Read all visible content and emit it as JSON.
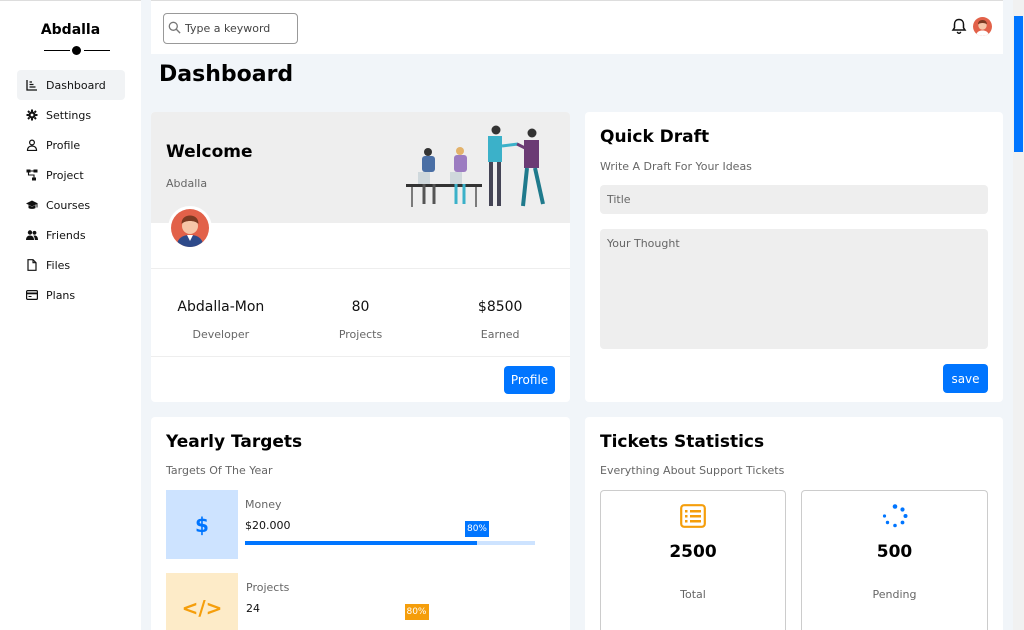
{
  "sidebar": {
    "brand": "Abdalla",
    "items": [
      {
        "label": "Dashboard",
        "icon": "chart-icon",
        "active": true
      },
      {
        "label": "Settings",
        "icon": "gear-icon"
      },
      {
        "label": "Profile",
        "icon": "user-icon"
      },
      {
        "label": "Project",
        "icon": "diagram-icon"
      },
      {
        "label": "Courses",
        "icon": "graduation-cap-icon"
      },
      {
        "label": "Friends",
        "icon": "users-icon"
      },
      {
        "label": "Files",
        "icon": "file-icon"
      },
      {
        "label": "Plans",
        "icon": "credit-card-icon"
      }
    ]
  },
  "topbar": {
    "search_placeholder": "Type a keyword",
    "notification_icon": "bell-icon",
    "avatar_icon": "avatar"
  },
  "page_title": "Dashboard",
  "welcome": {
    "title": "Welcome",
    "subtitle": "Abdalla",
    "stats": [
      {
        "value": "Abdalla-Mon",
        "label": "Developer"
      },
      {
        "value": "80",
        "label": "Projects"
      },
      {
        "value": "$8500",
        "label": "Earned"
      }
    ],
    "button": "Profile"
  },
  "quick_draft": {
    "title": "Quick Draft",
    "subtitle": "Write A Draft For Your Ideas",
    "title_placeholder": "Title",
    "thought_placeholder": "Your Thought",
    "button": "save"
  },
  "yearly_targets": {
    "title": "Yearly Targets",
    "subtitle": "Targets Of The Year",
    "items": [
      {
        "label": "Money",
        "value": "$20.000",
        "icon": "dollar-icon",
        "icon_text": "$",
        "progress": 80,
        "progress_text": "80%",
        "color": "#0075ff",
        "bg": "#cde3ff",
        "track": "#cde3ff"
      },
      {
        "label": "Projects",
        "value": "24",
        "icon": "code-icon",
        "icon_text": "</>",
        "progress": 55,
        "progress_text": "80%",
        "color": "#f59e0b",
        "bg": "#fdebc8",
        "track": "#fdebc8"
      }
    ]
  },
  "tickets": {
    "title": "Tickets Statistics",
    "subtitle": "Everything About Support Tickets",
    "items": [
      {
        "value": "2500",
        "label": "Total",
        "icon": "list-icon",
        "color": "#f59e0b"
      },
      {
        "value": "500",
        "label": "Pending",
        "icon": "spinner-icon",
        "color": "#0075ff"
      }
    ]
  },
  "colors": {
    "accent": "#0075ff",
    "warning": "#f59e0b"
  }
}
